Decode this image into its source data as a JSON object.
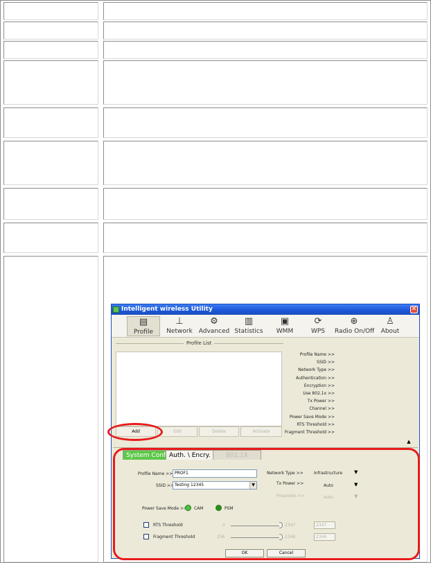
{
  "window": {
    "title": "Intelligent wireless Utility",
    "close_glyph": "✕"
  },
  "toolbar": [
    {
      "label": "Profile",
      "icon": "profile-icon",
      "glyph": "▤"
    },
    {
      "label": "Network",
      "icon": "network-icon",
      "glyph": "⊥"
    },
    {
      "label": "Advanced",
      "icon": "advanced-icon",
      "glyph": "⚙"
    },
    {
      "label": "Statistics",
      "icon": "statistics-icon",
      "glyph": "▥"
    },
    {
      "label": "WMM",
      "icon": "wmm-icon",
      "glyph": "▣"
    },
    {
      "label": "WPS",
      "icon": "wps-icon",
      "glyph": "⟳"
    },
    {
      "label": "Radio On/Off",
      "icon": "radio-icon",
      "glyph": "⊕"
    },
    {
      "label": "About",
      "icon": "about-icon",
      "glyph": "♙"
    }
  ],
  "profile_list": {
    "title": "Profile List",
    "fields": [
      "Profile Name >>",
      "SSID >>",
      "Network Type >>",
      "Authentication >>",
      "Encryption >>",
      "Use 802.1x >>",
      "Tx Power >>",
      "Channel >>",
      "Power Save Mode >>",
      "RTS Threshold >>",
      "Fragment Threshold >>"
    ],
    "buttons": {
      "add": "Add",
      "edit": "Edit",
      "delete": "Delete",
      "activate": "Activate"
    }
  },
  "config": {
    "tabs": {
      "system_config": "System Config",
      "auth": "Auth. \\ Encry.",
      "x8021": "802.1X"
    },
    "profile_name_label": "Profile Name >>",
    "profile_name_value": "PROF1",
    "ssid_label": "SSID >>",
    "ssid_value": "Testing 12345",
    "network_type_label": "Network Type >>",
    "network_type_value": "Infrastructure",
    "tx_power_label": "Tx Power >>",
    "tx_power_value": "Auto",
    "preamble_label": "Preamble >>",
    "preamble_value": "Auto",
    "power_save_label": "Power Save Mode >>",
    "cam_label": "CAM",
    "psm_label": "PSM",
    "rts_label": "RTS Threshold",
    "rts_min": "0",
    "rts_max": "2347",
    "rts_value": "2347",
    "frag_label": "Fragment Threshold",
    "frag_min": "256",
    "frag_max": "2346",
    "frag_value": "2346",
    "ok": "OK",
    "cancel": "Cancel"
  },
  "colors": {
    "highlight": "#e81b1b",
    "active_tab": "#5ec74a",
    "title_bar": "#1a56d6"
  }
}
